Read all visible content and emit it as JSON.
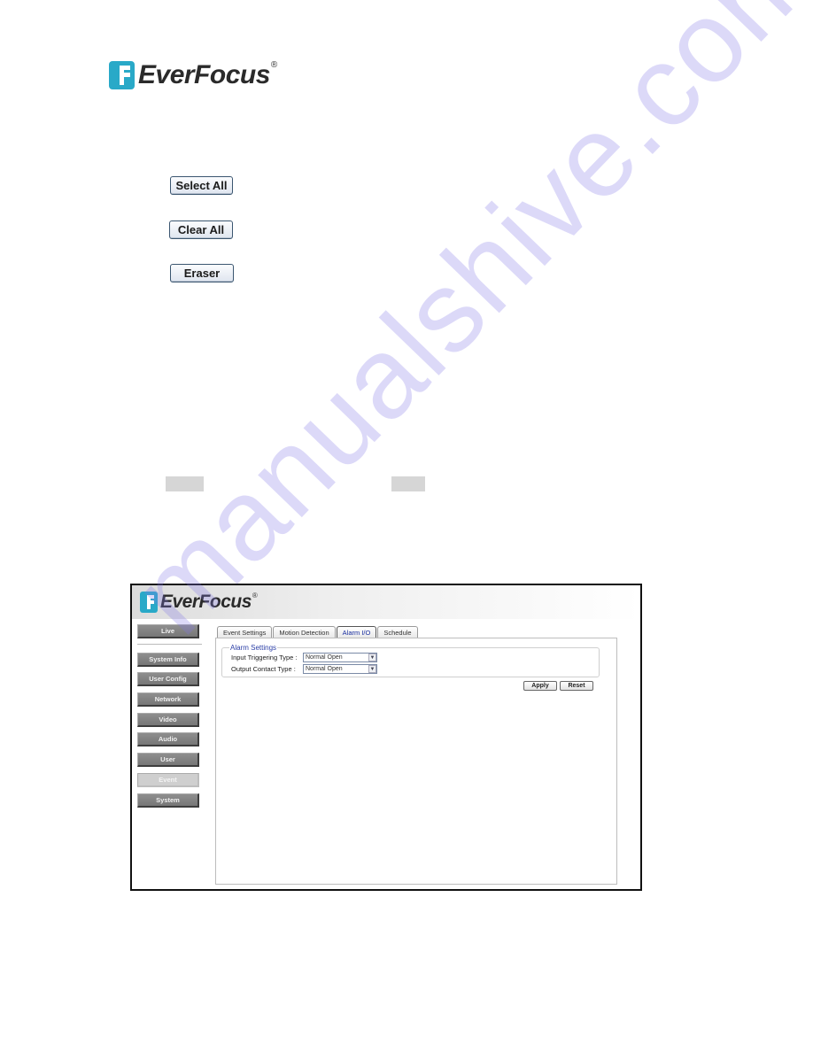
{
  "logo": {
    "brand": "EverFocus",
    "registered": "®",
    "icon": "everfocus-logo-icon",
    "brand_color": "#29a9c8"
  },
  "illustration_buttons": {
    "select_all": "Select All",
    "clear_all": "Clear All",
    "eraser": "Eraser"
  },
  "screenshot": {
    "logo": {
      "brand": "EverFocus",
      "registered": "®"
    },
    "nav": {
      "live": "Live",
      "items": [
        {
          "label": "System Info",
          "active": false
        },
        {
          "label": "User Config",
          "active": false
        },
        {
          "label": "Network",
          "active": false
        },
        {
          "label": "Video",
          "active": false
        },
        {
          "label": "Audio",
          "active": false
        },
        {
          "label": "User",
          "active": false
        },
        {
          "label": "Event",
          "active": true
        },
        {
          "label": "System",
          "active": false
        }
      ]
    },
    "tabs": [
      {
        "label": "Event Settings",
        "active": false
      },
      {
        "label": "Motion Detection",
        "active": false
      },
      {
        "label": "Alarm I/O",
        "active": true
      },
      {
        "label": "Schedule",
        "active": false
      }
    ],
    "alarm_settings": {
      "legend": "Alarm Settings",
      "input_triggering_label": "Input Triggering Type :",
      "input_triggering_value": "Normal Open",
      "output_contact_label": "Output Contact Type :",
      "output_contact_value": "Normal Open"
    },
    "actions": {
      "apply": "Apply",
      "reset": "Reset"
    }
  },
  "watermark": "manualshive.com"
}
